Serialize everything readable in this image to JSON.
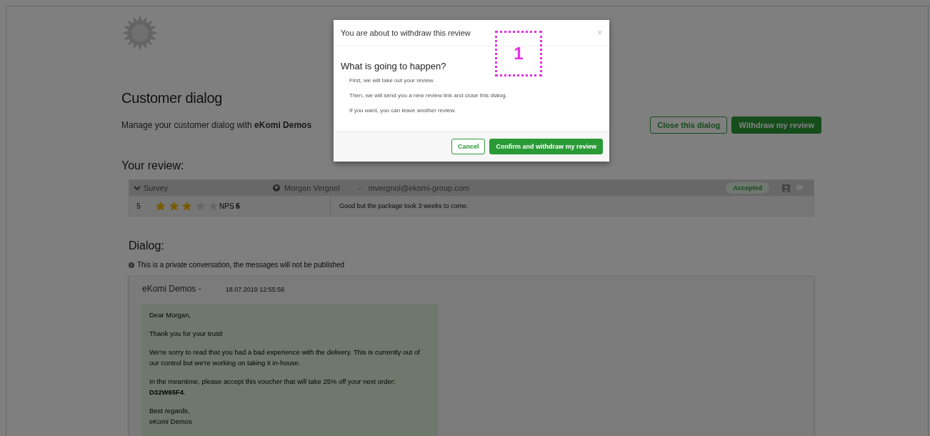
{
  "page": {
    "title": "Customer dialog",
    "subtitle": "Manage your customer dialog with **eKomi Demos**",
    "buttons": [
      {
        "label": "Close this dialog",
        "kind": "outline"
      },
      {
        "label": "Withdraw my review",
        "kind": "primary"
      }
    ]
  },
  "review": {
    "heading": "Your review:",
    "type": "Survey",
    "expanded": true,
    "customer": "Morgan Vergnol",
    "separator": "-",
    "email": "mvergnol@ekomi-group.com",
    "status": "Accepted",
    "score": "5",
    "stars": 3,
    "nps_label": "NPS",
    "nps": "6",
    "comment": "Good but the package took 3 weeks to come."
  },
  "dialog": {
    "heading": "Dialog:",
    "notice": "This is a private conversation, the messages will not be published",
    "messages": [
      {
        "author": "eKomi Demos -",
        "time": "18.07.2019 12:55:56",
        "paragraphs": [
          "Dear Morgan,",
          "Thank you for your trust!",
          "We're sorry to read that you had a bad experience with the delivery. This is currently out of our control but we're working on taking it in-house.",
          "In the meantime, please accept this voucher that will take 25% off your next order: **D32W65F4**.",
          "Best regards,\neKomi Demos"
        ]
      }
    ]
  },
  "modal": {
    "title": "You are about to withdraw this review",
    "close": "×",
    "heading": "What is going to happen?",
    "steps": [
      "First, we will take out your review.",
      "Then, we will send you a new review link and close this dialog.",
      "If you want, you can leave another review."
    ],
    "buttons": [
      {
        "label": "Cancel",
        "kind": "outline"
      },
      {
        "label": "Confirm and withdraw my review",
        "kind": "primary"
      }
    ]
  },
  "annotation": {
    "label": "1"
  }
}
